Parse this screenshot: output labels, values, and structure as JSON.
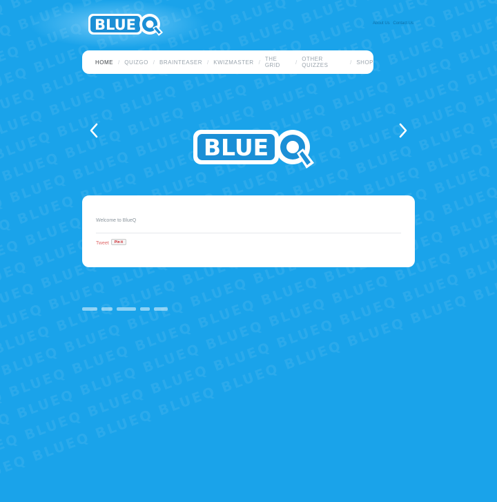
{
  "brand": {
    "logo_text": "BLUE",
    "logo_q": "Q",
    "colors": {
      "background": "#1aa3ea",
      "logo_blue": "#1b8fd6",
      "white": "#ffffff"
    }
  },
  "top_links": [
    {
      "label": "About Us"
    },
    {
      "label": "Contact Us"
    }
  ],
  "nav": {
    "items": [
      {
        "label": "HOME",
        "active": true
      },
      {
        "label": "QUIZGO"
      },
      {
        "label": "BRAINTEASER"
      },
      {
        "label": "KWIZMASTER"
      },
      {
        "label": "THE GRID"
      },
      {
        "label": "OTHER QUIZZES"
      },
      {
        "label": "SHOP"
      }
    ],
    "separator": "/"
  },
  "slider": {
    "prev_icon": "chevron-left-icon",
    "next_icon": "chevron-right-icon"
  },
  "content": {
    "welcome_text": "Welcome to BlueQ",
    "tweet_label": "Tweet",
    "pin_label": "Pin it"
  }
}
